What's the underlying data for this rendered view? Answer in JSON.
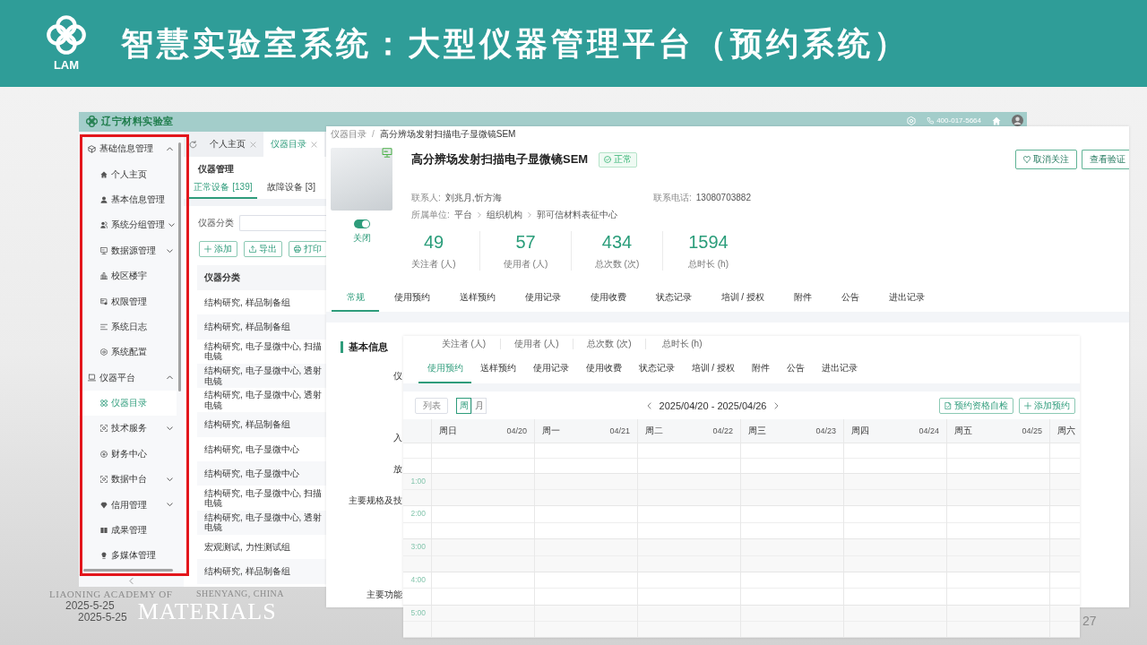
{
  "slide": {
    "logo_text": "LAM",
    "title": "智慧实验室系统：大型仪器管理平台（预约系统）",
    "page_number": "27",
    "dates": [
      "2025-5-25",
      "2025-5-25"
    ],
    "academy_line": "LIAONING ACADEMY OF",
    "academy_wordmark": "MATERIALS",
    "city": "SHENYANG, CHINA"
  },
  "admin_window": {
    "app_name": "辽宁材料实验室",
    "hotline": "400-017-5664",
    "sidebar": {
      "highlighted": true,
      "items": [
        {
          "label": "基础信息管理",
          "kind": "menu",
          "expanded": true,
          "selected": false,
          "children": [
            {
              "label": "个人主页",
              "kind": "page",
              "selected": false
            },
            {
              "label": "基本信息管理",
              "kind": "page",
              "selected": false
            },
            {
              "label": "系统分组管理",
              "kind": "menu",
              "expanded": false,
              "selected": false
            },
            {
              "label": "数据源管理",
              "kind": "menu",
              "expanded": false,
              "selected": false
            },
            {
              "label": "校区楼宇",
              "kind": "page",
              "selected": false
            },
            {
              "label": "权限管理",
              "kind": "page",
              "selected": false
            },
            {
              "label": "系统日志",
              "kind": "page",
              "selected": false
            },
            {
              "label": "系统配置",
              "kind": "page",
              "selected": false
            }
          ]
        },
        {
          "label": "仪器平台",
          "kind": "menu",
          "expanded": true,
          "selected": false,
          "children": [
            {
              "label": "仪器目录",
              "kind": "page",
              "selected": true
            },
            {
              "label": "技术服务",
              "kind": "menu",
              "expanded": false,
              "selected": false
            },
            {
              "label": "财务中心",
              "kind": "page",
              "selected": false
            },
            {
              "label": "数据中台",
              "kind": "menu",
              "expanded": false,
              "selected": false
            },
            {
              "label": "信用管理",
              "kind": "menu",
              "expanded": false,
              "selected": false
            },
            {
              "label": "成果管理",
              "kind": "page",
              "selected": false
            },
            {
              "label": "多媒体管理",
              "kind": "page",
              "selected": false
            }
          ]
        }
      ]
    },
    "tabs": [
      {
        "label": "个人主页",
        "selected": false
      },
      {
        "label": "仪器目录",
        "selected": true
      }
    ],
    "panel_title": "仪器管理",
    "device_tabs": [
      {
        "label": "正常设备 [139]",
        "selected": true
      },
      {
        "label": "故障设备 [3]",
        "selected": false
      }
    ],
    "filter_label": "仪器分类",
    "actions": [
      "添加",
      "导出",
      "打印"
    ],
    "table": {
      "columns": [
        "仪器分类"
      ],
      "rows": [
        [
          "结构研究, 样品制备组"
        ],
        [
          "结构研究, 样品制备组"
        ],
        [
          "结构研究, 电子显微中心, 扫描电镜"
        ],
        [
          "结构研究, 电子显微中心, 透射电镜"
        ],
        [
          "结构研究, 电子显微中心, 透射电镜"
        ],
        [
          "结构研究, 样品制备组"
        ],
        [
          "结构研究, 电子显微中心"
        ],
        [
          "结构研究, 电子显微中心"
        ],
        [
          "结构研究, 电子显微中心, 扫描电镜"
        ],
        [
          "结构研究, 电子显微中心, 透射电镜"
        ],
        [
          "宏观测试, 力性测试组"
        ],
        [
          "结构研究, 样品制备组"
        ]
      ]
    }
  },
  "detail_window": {
    "breadcrumb": [
      "仪器目录",
      "高分辨场发射扫描电子显微镜SEM"
    ],
    "breadcrumb_separator": "/",
    "name": "高分辨场发射扫描电子显微镜SEM",
    "status": "正常",
    "power": {
      "on": true,
      "label": "关闭"
    },
    "buttons": [
      "取消关注",
      "查看验证"
    ],
    "contact": {
      "label": "联系人:",
      "value": "刘兆月,忻方海"
    },
    "phone": {
      "label": "联系电话:",
      "value": "13080703882"
    },
    "unit": {
      "label": "所属单位:",
      "path": [
        "平台",
        "组织机构",
        "郭可信材料表征中心"
      ]
    },
    "stats": [
      {
        "value": "49",
        "label": "关注者 (人)"
      },
      {
        "value": "57",
        "label": "使用者 (人)"
      },
      {
        "value": "434",
        "label": "总次数 (次)"
      },
      {
        "value": "1594",
        "label": "总时长 (h)"
      }
    ],
    "tabs": [
      {
        "label": "常规",
        "selected": true
      },
      {
        "label": "使用预约",
        "selected": false
      },
      {
        "label": "送样预约",
        "selected": false
      },
      {
        "label": "使用记录",
        "selected": false
      },
      {
        "label": "使用收费",
        "selected": false
      },
      {
        "label": "状态记录",
        "selected": false
      },
      {
        "label": "培训 / 授权",
        "selected": false
      },
      {
        "label": "附件",
        "selected": false
      },
      {
        "label": "公告",
        "selected": false
      },
      {
        "label": "进出记录",
        "selected": false
      }
    ],
    "section_title": "基本信息",
    "field_labels": [
      "仪",
      "入",
      "放",
      "主要规格及技",
      "主要功能"
    ]
  },
  "calendar_window": {
    "stat_labels": [
      "关注者 (人)",
      "使用者 (人)",
      "总次数 (次)",
      "总时长 (h)"
    ],
    "tabs": [
      {
        "label": "使用预约",
        "selected": true
      },
      {
        "label": "送样预约",
        "selected": false
      },
      {
        "label": "使用记录",
        "selected": false
      },
      {
        "label": "使用收费",
        "selected": false
      },
      {
        "label": "状态记录",
        "selected": false
      },
      {
        "label": "培训 / 授权",
        "selected": false
      },
      {
        "label": "附件",
        "selected": false
      },
      {
        "label": "公告",
        "selected": false
      },
      {
        "label": "进出记录",
        "selected": false
      }
    ],
    "list_view": "列表",
    "periods": [
      {
        "label": "周",
        "selected": true
      },
      {
        "label": "月",
        "selected": false
      }
    ],
    "range": "2025/04/20 - 2025/04/26",
    "actions": [
      "预约资格自检",
      "添加预约"
    ],
    "days": [
      {
        "name": "周日",
        "date": "04/20"
      },
      {
        "name": "周一",
        "date": "04/21"
      },
      {
        "name": "周二",
        "date": "04/22"
      },
      {
        "name": "周三",
        "date": "04/23"
      },
      {
        "name": "周四",
        "date": "04/24"
      },
      {
        "name": "周五",
        "date": "04/25"
      },
      {
        "name": "周六"
      }
    ],
    "hours": [
      "1:00",
      "2:00",
      "3:00",
      "4:00",
      "5:00"
    ]
  }
}
